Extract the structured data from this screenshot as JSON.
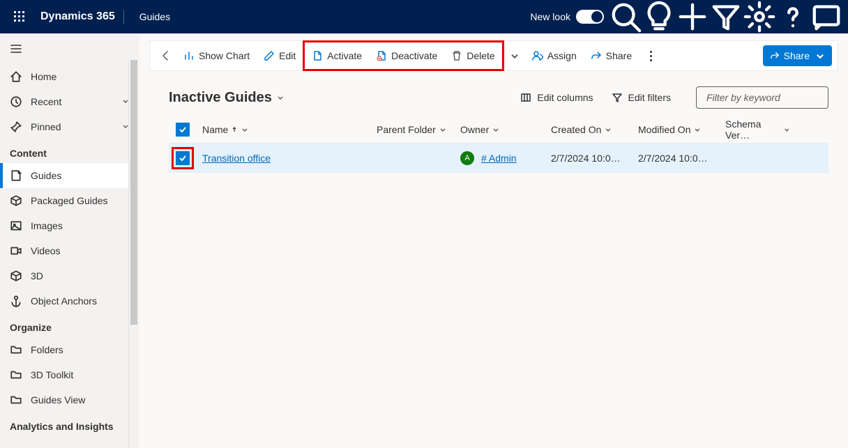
{
  "topbar": {
    "product": "Dynamics 365",
    "app": "Guides",
    "newlook_label": "New look"
  },
  "sidebar": {
    "home": "Home",
    "recent": "Recent",
    "pinned": "Pinned",
    "groups": {
      "content": "Content",
      "organize": "Organize",
      "analytics": "Analytics and Insights"
    },
    "content_items": {
      "guides": "Guides",
      "packaged": "Packaged Guides",
      "images": "Images",
      "videos": "Videos",
      "threedee": "3D",
      "anchors": "Object Anchors"
    },
    "organize_items": {
      "folders": "Folders",
      "toolkit": "3D Toolkit",
      "guidesview": "Guides View"
    }
  },
  "cmd": {
    "show_chart": "Show Chart",
    "edit": "Edit",
    "activate": "Activate",
    "deactivate": "Deactivate",
    "delete": "Delete",
    "assign": "Assign",
    "share": "Share",
    "share_btn": "Share"
  },
  "view": {
    "title": "Inactive Guides",
    "edit_columns": "Edit columns",
    "edit_filters": "Edit filters",
    "search_placeholder": "Filter by keyword"
  },
  "grid": {
    "cols": {
      "name": "Name",
      "parent": "Parent Folder",
      "owner": "Owner",
      "created": "Created On",
      "modified": "Modified On",
      "schema": "Schema Ver…"
    },
    "rows": [
      {
        "name": "Transition office",
        "parent": "",
        "owner_label": "# Admin",
        "owner_initial": "A",
        "created": "2/7/2024 10:0…",
        "modified": "2/7/2024 10:0…",
        "schema": ""
      }
    ]
  }
}
